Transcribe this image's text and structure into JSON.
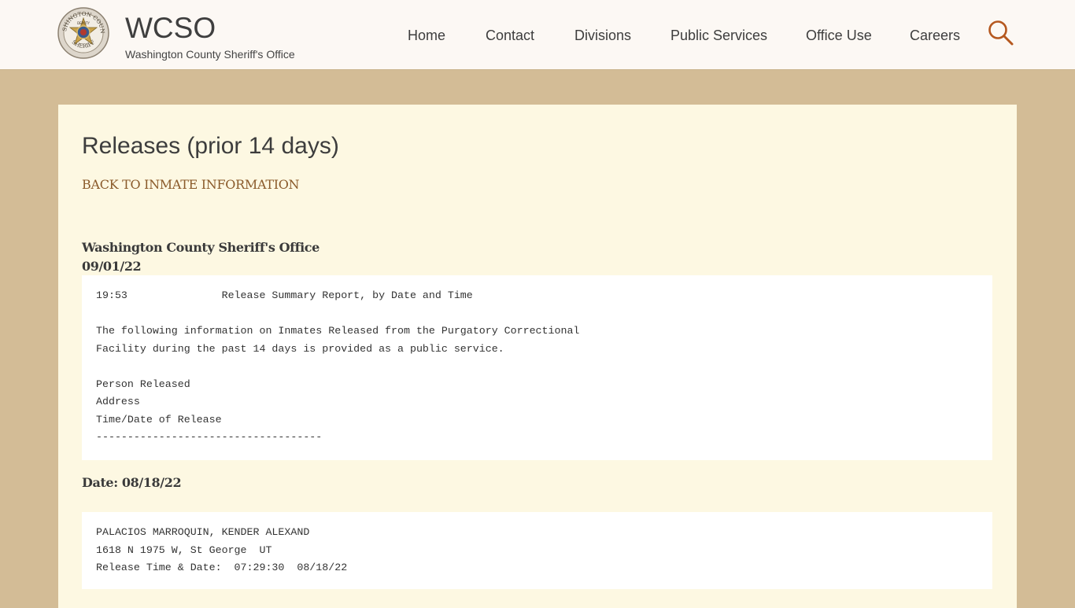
{
  "header": {
    "logo_text_top": "WASHINGTON COUNTY",
    "logo_text_bottom": "SHERIFF",
    "logo_badge_text": "DEPUTY",
    "title": "WCSO",
    "subtitle": "Washington County Sheriff's Office",
    "nav": [
      {
        "label": "Home"
      },
      {
        "label": "Contact"
      },
      {
        "label": "Divisions"
      },
      {
        "label": "Public Services"
      },
      {
        "label": "Office Use"
      },
      {
        "label": "Careers"
      }
    ],
    "search_icon": "search-icon"
  },
  "page": {
    "title": "Releases (prior 14 days)",
    "back_link": "BACK TO INMATE INFORMATION",
    "office_name": "Washington County Sheriff's Office",
    "report_date": "09/01/22",
    "report_lines": [
      "19:53               Release Summary Report, by Date and Time",
      "",
      "The following information on Inmates Released from the Purgatory Correctional",
      "Facility during the past 14 days is provided as a public service.",
      "",
      "Person Released",
      "Address",
      "Time/Date of Release",
      "------------------------------------"
    ],
    "date_heading": "Date: 08/18/22",
    "records": [
      {
        "name": "PALACIOS MARROQUIN, KENDER ALEXAND",
        "address": "1618 N 1975 W, St George  UT",
        "release": "Release Time & Date:  07:29:30  08/18/22"
      }
    ]
  },
  "colors": {
    "page_background": "#d3bc96",
    "header_background": "#fcf8f4",
    "content_background": "#fdf8e2",
    "link_color": "#8a5a2a",
    "search_icon_color": "#b5581f"
  }
}
